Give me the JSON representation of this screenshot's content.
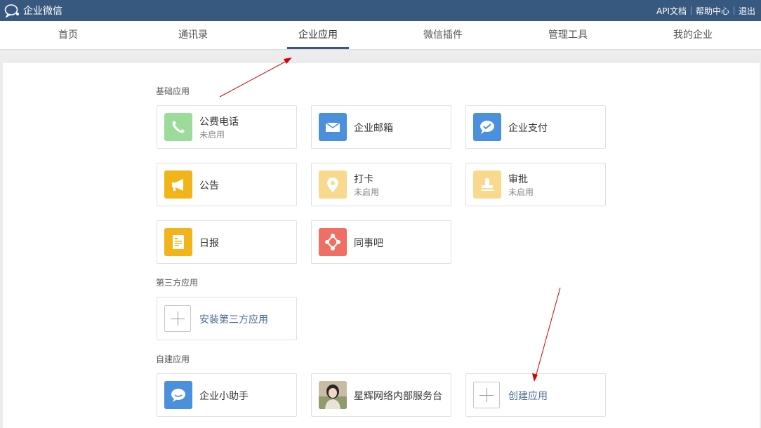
{
  "topbar": {
    "logo_text": "企业微信",
    "links": [
      "API文档",
      "帮助中心",
      "退出"
    ]
  },
  "nav": {
    "tabs": [
      "首页",
      "通讯录",
      "企业应用",
      "微信插件",
      "管理工具",
      "我的企业"
    ],
    "active_index": 2
  },
  "sections": {
    "basic": "基础应用",
    "third_party": "第三方应用",
    "custom": "自建应用"
  },
  "apps": {
    "phone": {
      "name": "公费电话",
      "status": "未启用",
      "icon": "phone-icon",
      "color": "#9ddb9a"
    },
    "mail": {
      "name": "企业邮箱",
      "icon": "mail-icon",
      "color": "#4a90dc"
    },
    "pay": {
      "name": "企业支付",
      "icon": "pay-icon",
      "color": "#4a90dc"
    },
    "notice": {
      "name": "公告",
      "icon": "megaphone-icon",
      "color": "#f1b41a"
    },
    "checkin": {
      "name": "打卡",
      "status": "未启用",
      "icon": "location-icon",
      "color": "#f8d98e"
    },
    "approval": {
      "name": "审批",
      "status": "未启用",
      "icon": "stamp-icon",
      "color": "#f8d98e"
    },
    "daily": {
      "name": "日报",
      "icon": "report-icon",
      "color": "#f1b41a"
    },
    "colleague": {
      "name": "同事吧",
      "icon": "network-icon",
      "color": "#ef6f64"
    },
    "install_third": {
      "name": "安装第三方应用"
    },
    "assistant": {
      "name": "企业小助手",
      "icon": "chat-bubble-icon",
      "color": "#4a90dc"
    },
    "service_desk": {
      "name": "星辉网络内部服务台",
      "icon": "avatar-photo"
    },
    "create": {
      "name": "创建应用"
    }
  },
  "colors": {
    "topbar": "#38597f",
    "annotation_arrow": "#d40000"
  }
}
